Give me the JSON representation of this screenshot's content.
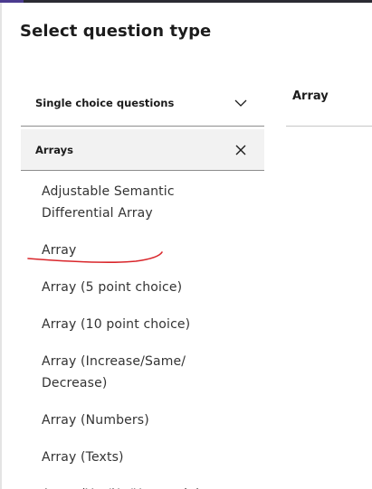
{
  "header": {
    "title": "Select question type"
  },
  "category_select": {
    "selected": "Single choice questions",
    "icon": "chevron-down-icon"
  },
  "preview": {
    "label": "Array"
  },
  "search": {
    "value": "Arrays",
    "clear_icon": "close-icon"
  },
  "options": [
    "Adjustable Semantic Differential Array",
    "Array",
    "Array (5 point choice)",
    "Array (10 point choice)",
    "Array (Increase/Same/ Decrease)",
    "Array (Numbers)",
    "Array (Texts)",
    "Array (Yes/No/Uncertain)"
  ],
  "colors": {
    "annotation_underline": "#d9262b",
    "search_background": "#f2f2f2"
  }
}
